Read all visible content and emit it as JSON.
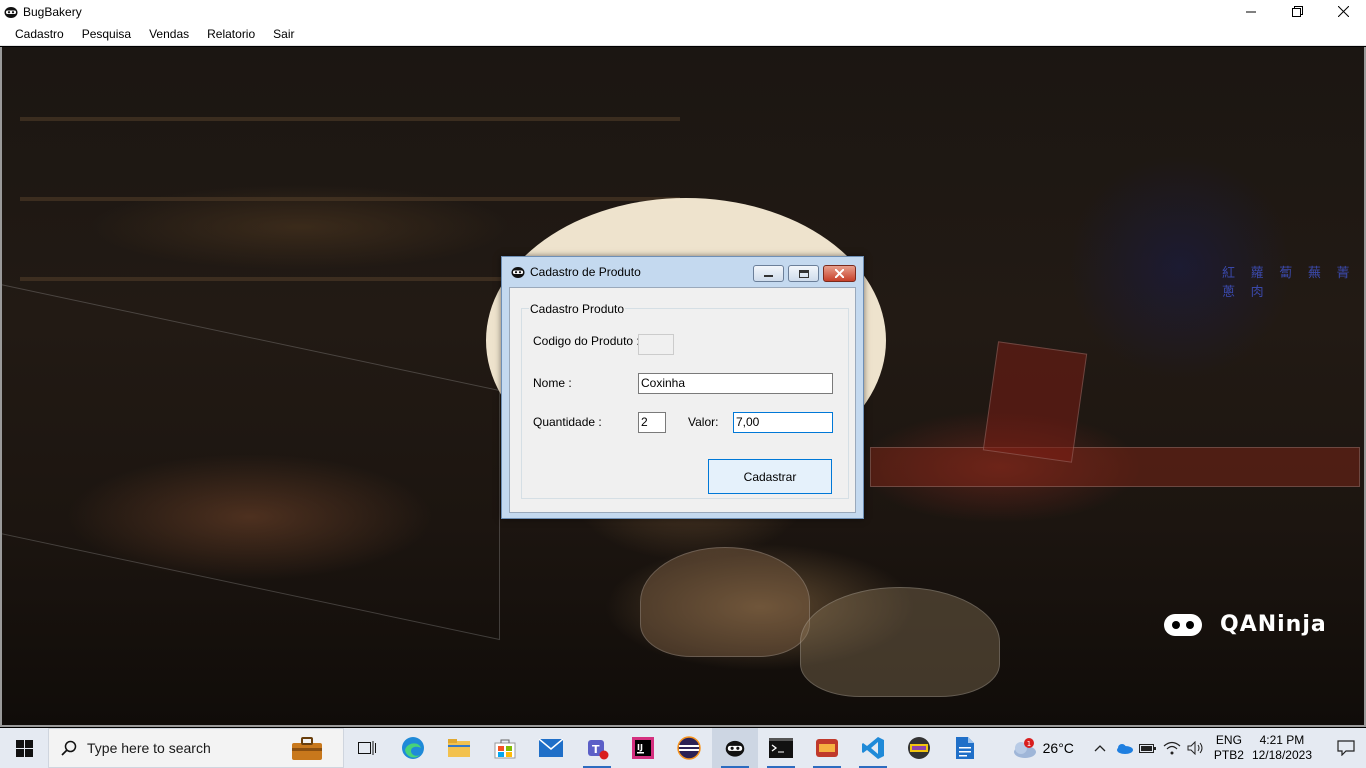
{
  "app": {
    "title": "BugBakery",
    "menu": [
      "Cadastro",
      "Pesquisa",
      "Vendas",
      "Relatorio",
      "Sair"
    ]
  },
  "background": {
    "watermark": "QANinja",
    "sign_text": "紅 蘿 蔔  蕪 菁  蔥  肉"
  },
  "dialog": {
    "title": "Cadastro de Produto",
    "group_title": "Cadastro Produto",
    "codigo_label": "Codigo do Produto :",
    "codigo_value": "",
    "nome_label": "Nome :",
    "nome_value": "Coxinha",
    "quantidade_label": "Quantidade :",
    "quantidade_value": "2",
    "valor_label": "Valor:",
    "valor_value": "7,00",
    "submit_label": "Cadastrar"
  },
  "taskbar": {
    "search_placeholder": "Type here to search",
    "weather_temp": "26°C",
    "weather_badge": "1",
    "lang_top": "ENG",
    "lang_bottom": "PTB2",
    "time": "4:21 PM",
    "date": "12/18/2023"
  },
  "colors": {
    "accent": "#0078d7",
    "dialog_frame": "#c4d9ef",
    "taskbar": "#e5eaf2"
  }
}
